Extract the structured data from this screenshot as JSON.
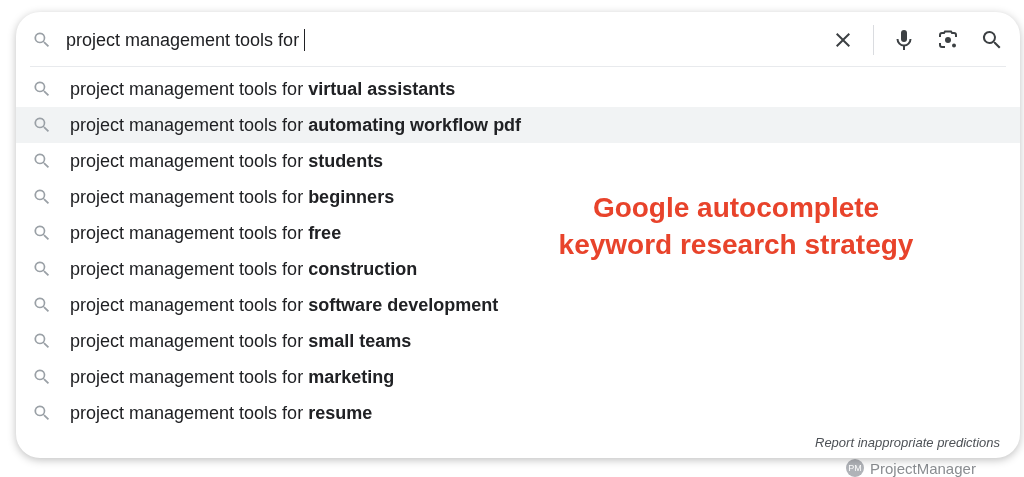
{
  "search": {
    "value": "project management tools for "
  },
  "suggestions": [
    {
      "text": "project management tools for **virtual assistants**",
      "selected": false
    },
    {
      "text": "project management tools for **automating workflow pdf**",
      "selected": true
    },
    {
      "text": "project management tools for **students**",
      "selected": false
    },
    {
      "text": "project management tools for **beginners**",
      "selected": false
    },
    {
      "text": "project management tools for **free**",
      "selected": false
    },
    {
      "text": "project management tools for **construction**",
      "selected": false
    },
    {
      "text": "project management tools for **software development**",
      "selected": false
    },
    {
      "text": "project management tools for **small teams**",
      "selected": false
    },
    {
      "text": "project management tools for **marketing**",
      "selected": false
    },
    {
      "text": "project management tools for **resume**",
      "selected": false
    }
  ],
  "annotation": {
    "lines": [
      "Google autocomplete",
      "keyword research strategy"
    ]
  },
  "report_link": "Report inappropriate predictions",
  "background": {
    "badge": "PM",
    "site_name": "ProjectManager"
  }
}
